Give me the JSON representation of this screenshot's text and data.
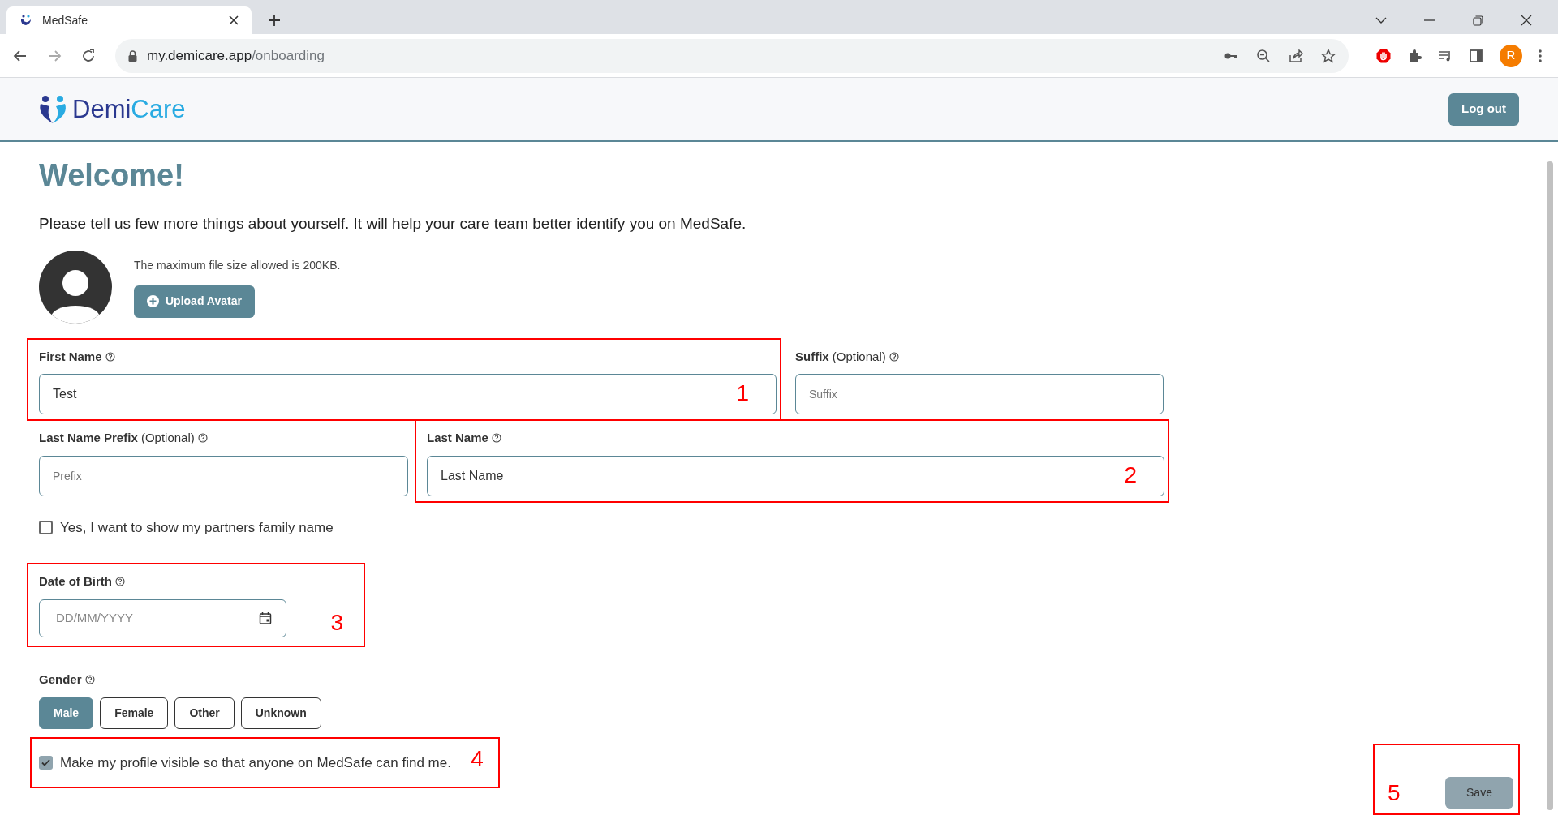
{
  "browser": {
    "tab_title": "MedSafe",
    "url_host": "my.demicare.app",
    "url_path": "/onboarding",
    "profile_initial": "R"
  },
  "header": {
    "logo_parts": [
      "Demi",
      "Care"
    ],
    "logout_button": "Log out"
  },
  "title": "Welcome!",
  "intro": "Please tell us few more things about yourself. It will help your care team better identify you on MedSafe.",
  "avatar": {
    "note": "The maximum file size allowed is 200KB.",
    "upload_button": "Upload Avatar"
  },
  "field_rows": [
    [
      {
        "label": "First Name",
        "value": "Test",
        "annotation": "1"
      },
      {
        "label": "Suffix",
        "optional": "(Optional)",
        "placeholder": "Suffix"
      }
    ],
    [
      {
        "label": "Last Name Prefix",
        "optional": "(Optional)",
        "placeholder": "Prefix"
      },
      {
        "label": "Last Name",
        "value": "Last Name",
        "annotation": "2"
      }
    ]
  ],
  "partner_checkbox": {
    "label": "Yes, I want to show my partners family name",
    "checked": false
  },
  "date_of_birth": {
    "label": "Date of Birth",
    "placeholder": "DD/MM/YYYY",
    "annotation": "3"
  },
  "gender": {
    "label": "Gender",
    "options": [
      {
        "label": "Male",
        "selected": true
      },
      {
        "label": "Female",
        "selected": false
      },
      {
        "label": "Other",
        "selected": false
      },
      {
        "label": "Unknown",
        "selected": false
      }
    ]
  },
  "visibility_checkbox": {
    "label": "Make my profile visible so that anyone on MedSafe can find me.",
    "checked": true,
    "annotation": "4"
  },
  "save_button": {
    "label": "Save",
    "disabled": true,
    "annotation": "5"
  }
}
